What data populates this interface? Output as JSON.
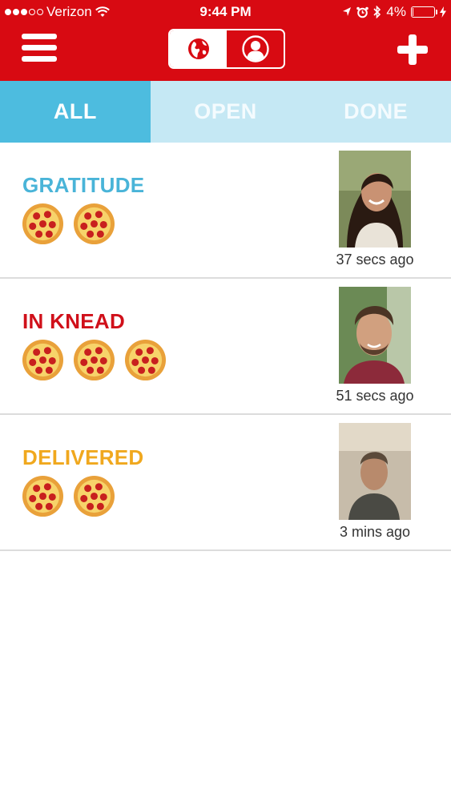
{
  "status_bar": {
    "carrier": "Verizon",
    "signal_bars_filled": 3,
    "signal_bars_total": 5,
    "time": "9:44 PM",
    "battery": "4%",
    "battery_level": 0.04
  },
  "nav": {
    "menu_icon": "hamburger-menu-icon",
    "segments": [
      {
        "icon": "globe-icon",
        "selected": true
      },
      {
        "icon": "user-profile-icon",
        "selected": false
      }
    ],
    "add_icon": "plus-icon"
  },
  "tabs": [
    {
      "label": "ALL",
      "active": true
    },
    {
      "label": "OPEN",
      "active": false
    },
    {
      "label": "DONE",
      "active": false
    }
  ],
  "items": [
    {
      "title": "GRATITUDE",
      "title_color": "#49b4d8",
      "pizza_count": 2,
      "time_ago": "37 secs ago"
    },
    {
      "title": "IN KNEAD",
      "title_color": "#d0101a",
      "pizza_count": 3,
      "time_ago": "51 secs ago"
    },
    {
      "title": "DELIVERED",
      "title_color": "#f0a81e",
      "pizza_count": 2,
      "time_ago": "3 mins ago"
    }
  ],
  "colors": {
    "brand_red": "#d80a12",
    "tab_active": "#4dbcdf",
    "tab_inactive_bg": "#c5e8f4"
  }
}
